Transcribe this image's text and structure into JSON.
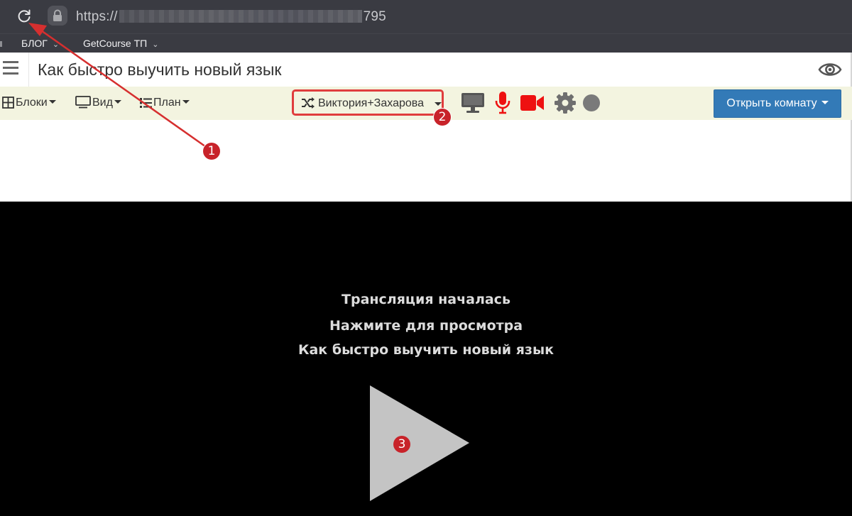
{
  "browser": {
    "url_prefix": "https://",
    "url_suffix": "795",
    "bookmarks": [
      {
        "label": "БЛОГ"
      },
      {
        "label": "GetCourse ТП"
      }
    ]
  },
  "header": {
    "title": "Как быстро выучить новый язык"
  },
  "toolbar": {
    "menus": [
      {
        "label": "Блоки",
        "icon": "grid-icon"
      },
      {
        "label": "Вид",
        "icon": "monitor-icon"
      },
      {
        "label": "План",
        "icon": "list-icon"
      }
    ],
    "user_select_label": "Виктория+Захарова",
    "open_room_label": "Открыть комнату",
    "colors": {
      "background": "#f3f4e0",
      "media_active": "#ee1111",
      "button": "#337ab7"
    }
  },
  "player": {
    "line1": "Трансляция началась",
    "line2": "Нажмите для просмотра",
    "line3": "Как быстро выучить новый язык"
  },
  "annotations": {
    "badge1": "1",
    "badge2": "2",
    "badge3": "3",
    "color": "#c8232a"
  }
}
